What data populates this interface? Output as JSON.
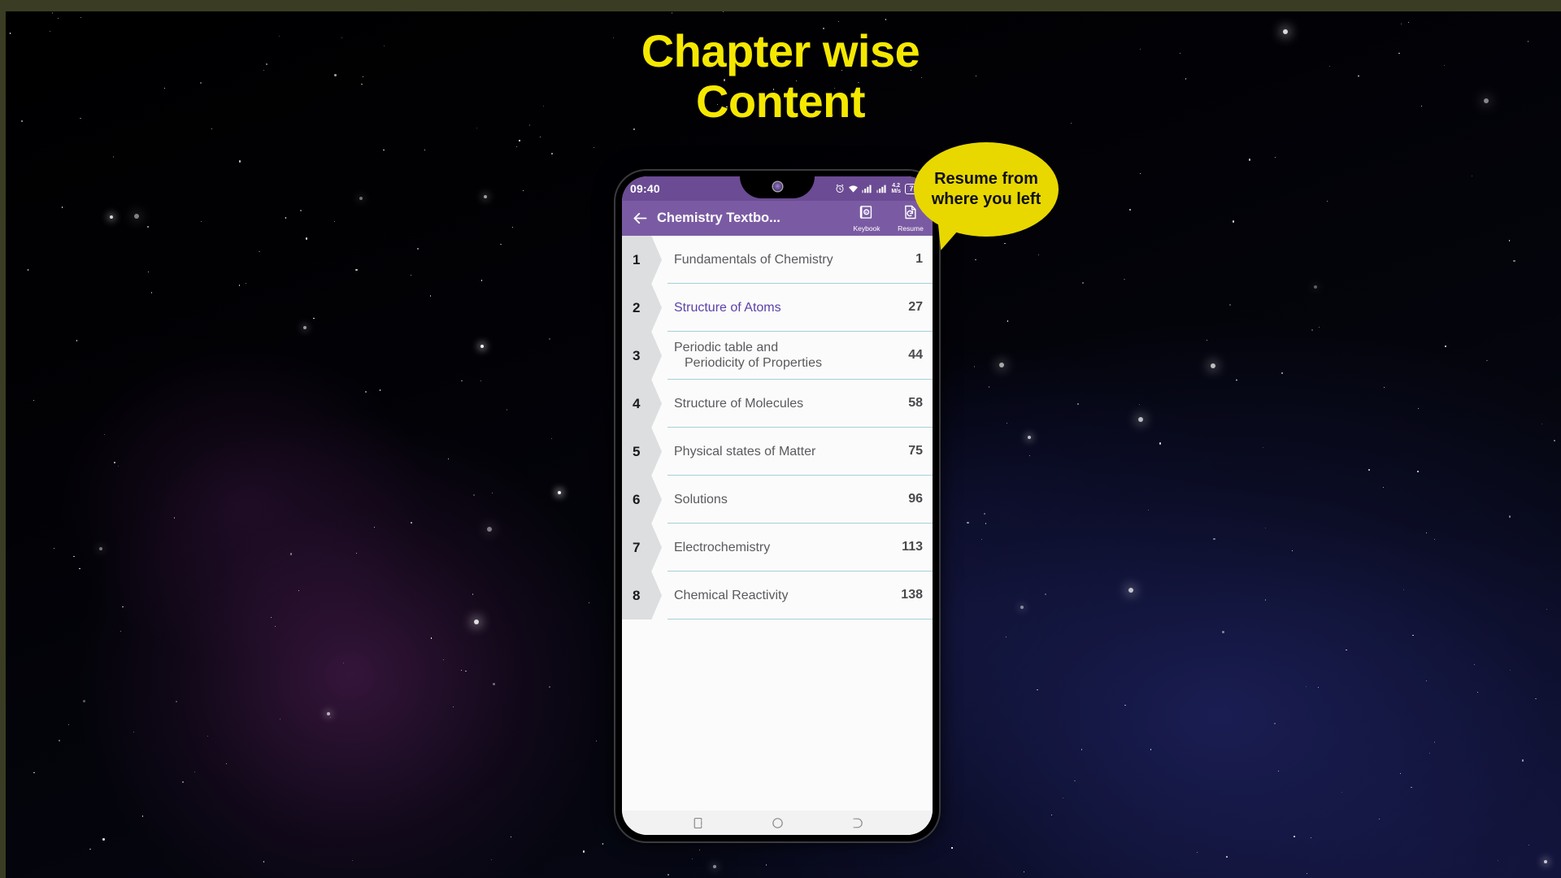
{
  "heading": {
    "line1": "Chapter wise",
    "line2": "Content",
    "color": "#f5e800"
  },
  "callout": {
    "text": "Resume from where you left",
    "bg_color": "#e8d800",
    "text_color": "#111111"
  },
  "phone": {
    "status_bar": {
      "clock": "09:40",
      "network_speed_value": "4.2",
      "network_speed_unit": "M/s",
      "battery_percent": "75",
      "icons": [
        "alarm-clock-icon",
        "wifi-icon",
        "signal-sim1-icon",
        "signal-sim2-icon"
      ],
      "bg_color": "#6b4b93"
    },
    "app_bar": {
      "back_label": "back-arrow",
      "title": "Chemistry Textbo...",
      "actions": [
        {
          "label": "Keybook",
          "icon": "keybook-icon"
        },
        {
          "label": "Resume",
          "icon": "resume-icon"
        }
      ],
      "bg_color": "#7a5ba3"
    },
    "chapters": [
      {
        "num": "1",
        "title": "Fundamentals of Chemistry",
        "title_line2": "",
        "page": "1",
        "visited": false
      },
      {
        "num": "2",
        "title": "Structure of Atoms",
        "title_line2": "",
        "page": "27",
        "visited": true
      },
      {
        "num": "3",
        "title": "Periodic table and",
        "title_line2": "Periodicity of Properties",
        "page": "44",
        "visited": false
      },
      {
        "num": "4",
        "title": "Structure of Molecules",
        "title_line2": "",
        "page": "58",
        "visited": false
      },
      {
        "num": "5",
        "title": "Physical states of Matter",
        "title_line2": "",
        "page": "75",
        "visited": false
      },
      {
        "num": "6",
        "title": "Solutions",
        "title_line2": "",
        "page": "96",
        "visited": false
      },
      {
        "num": "7",
        "title": "Electrochemistry",
        "title_line2": "",
        "page": "113",
        "visited": false
      },
      {
        "num": "8",
        "title": "Chemical Reactivity",
        "title_line2": "",
        "page": "138",
        "visited": false
      }
    ],
    "nav_bar": {
      "buttons": [
        "recents-icon",
        "home-icon",
        "back-icon"
      ]
    }
  }
}
